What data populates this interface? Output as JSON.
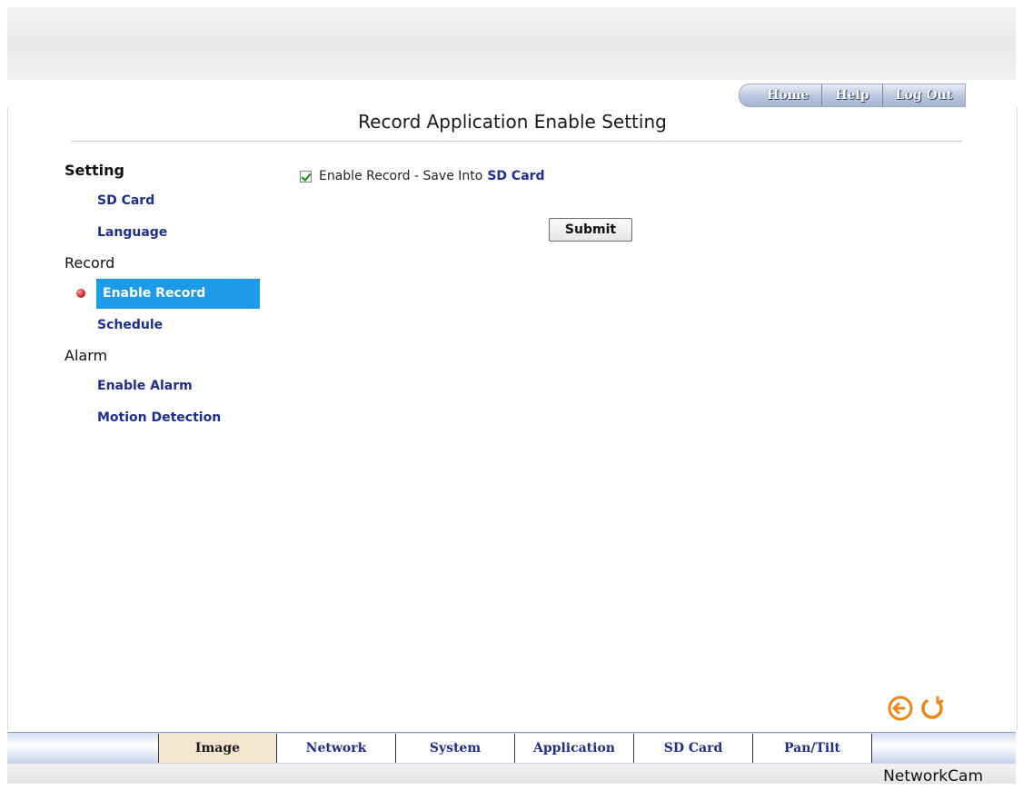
{
  "top_nav": {
    "home": "Home",
    "help": "Help",
    "logout": "Log Out"
  },
  "page": {
    "title": "Record Application Enable Setting"
  },
  "sidebar": {
    "groups": [
      {
        "header": "Setting",
        "items": [
          "SD Card",
          "Language"
        ]
      },
      {
        "header": "Record",
        "items": [
          "Enable Record",
          "Schedule"
        ],
        "active": "Enable Record"
      },
      {
        "header": "Alarm",
        "items": [
          "Enable Alarm",
          "Motion Detection"
        ]
      }
    ]
  },
  "content": {
    "enable_checkbox_checked": true,
    "enable_label": "Enable Record - Save Into",
    "enable_label_link": "SD Card",
    "submit_label": "Submit"
  },
  "bottom_nav": {
    "tabs": [
      "Image",
      "Network",
      "System",
      "Application",
      "SD Card",
      "Pan/Tilt"
    ],
    "active": "Image"
  },
  "footer": {
    "brand": "NetworkCam"
  },
  "colors": {
    "accent_active": "#1e9be8",
    "link": "#1d2f8c",
    "icon_orange": "#e8891a"
  },
  "icons": {
    "back": "back-arrow-icon",
    "refresh": "refresh-icon",
    "bullet": "red-bullet-icon"
  }
}
